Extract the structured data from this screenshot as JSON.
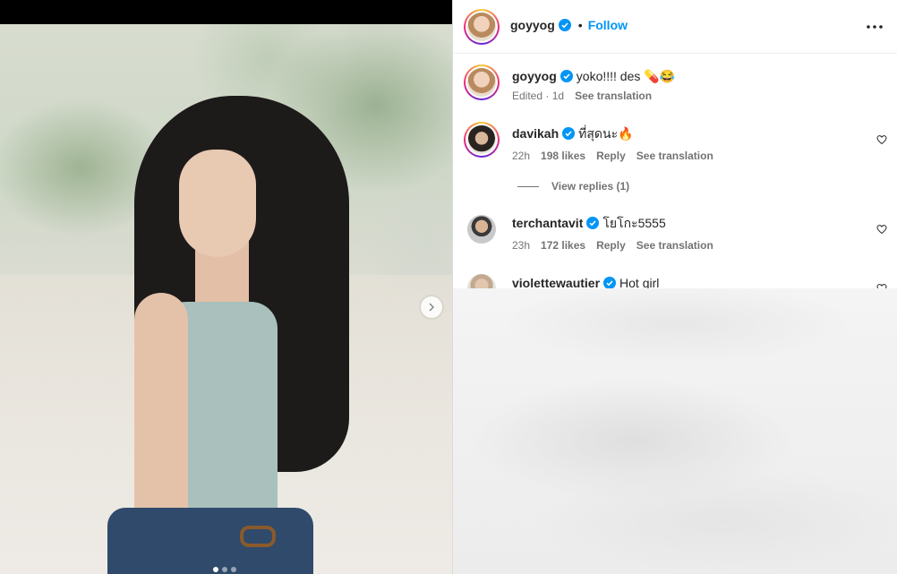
{
  "header": {
    "username": "goyyog",
    "separator": "•",
    "follow_label": "Follow",
    "more_icon": "more-horizontal-icon"
  },
  "caption": {
    "username": "goyyog",
    "text": "yoko!!!! des 💊😂",
    "edited_label": "Edited",
    "age": "1d",
    "see_translation": "See translation"
  },
  "comments": [
    {
      "username": "davikah",
      "text": "ที่สุดนะ🔥",
      "age": "22h",
      "likes": "198 likes",
      "reply": "Reply",
      "see_translation": "See translation",
      "view_replies": "View replies (1)"
    },
    {
      "username": "terchantavit",
      "text": "โยโกะ5555",
      "age": "23h",
      "likes": "172 likes",
      "reply": "Reply",
      "see_translation": "See translation"
    },
    {
      "username": "violettewautier",
      "text": "Hot girl"
    }
  ],
  "colors": {
    "accent": "#0095f6",
    "verified": "#0095f6",
    "muted": "#737373"
  }
}
